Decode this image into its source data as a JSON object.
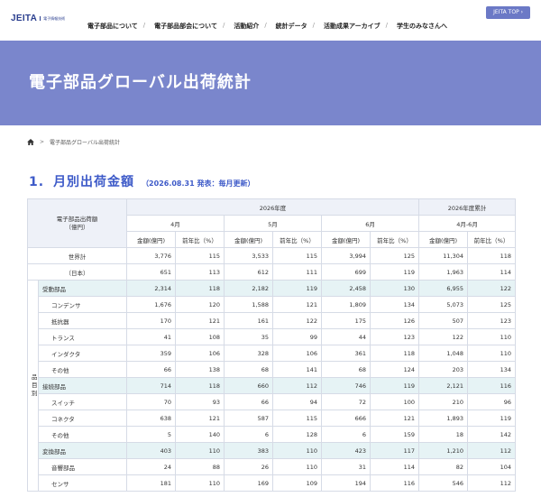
{
  "header": {
    "logo_text": "JEITA",
    "logo_sub": "電子情報技術",
    "top_button": "JEITA TOP ›",
    "nav": [
      "電子部品について",
      "電子部品部会について",
      "活動紹介",
      "統計データ",
      "活動成果アーカイブ",
      "学生のみなさんへ"
    ]
  },
  "banner": {
    "title": "電子部品グローバル出荷統計"
  },
  "breadcrumb": {
    "arrow": ">",
    "current": "電子部品グローバル出荷統計"
  },
  "section": {
    "number": "1.",
    "title": "月別出荷金額",
    "note": "（2026.08.31 発表：毎月更新）"
  },
  "table": {
    "corner": "電子部品出荷額\n（億円）",
    "year_header": "2026年度",
    "cum_header": "2026年度累計",
    "months": [
      "4月",
      "5月",
      "6月",
      "4月-6月"
    ],
    "sub_amount": "金額(億円)",
    "sub_ratio": "前年比（%）",
    "side_label": "品\n目\n別",
    "rows": [
      {
        "name": "世界計",
        "vals": [
          "3,776",
          "115",
          "3,533",
          "115",
          "3,994",
          "125",
          "11,304",
          "118"
        ],
        "group": false,
        "indent": false
      },
      {
        "name": "（日本）",
        "vals": [
          "651",
          "113",
          "612",
          "111",
          "699",
          "119",
          "1,963",
          "114"
        ],
        "group": false,
        "indent": false
      },
      {
        "name": "受動部品",
        "vals": [
          "2,314",
          "118",
          "2,182",
          "119",
          "2,458",
          "130",
          "6,955",
          "122"
        ],
        "group": true,
        "indent": false
      },
      {
        "name": "コンデンサ",
        "vals": [
          "1,676",
          "120",
          "1,588",
          "121",
          "1,809",
          "134",
          "5,073",
          "125"
        ],
        "group": false,
        "indent": true
      },
      {
        "name": "抵抗器",
        "vals": [
          "170",
          "121",
          "161",
          "122",
          "175",
          "126",
          "507",
          "123"
        ],
        "group": false,
        "indent": true
      },
      {
        "name": "トランス",
        "vals": [
          "41",
          "108",
          "35",
          "99",
          "44",
          "123",
          "122",
          "110"
        ],
        "group": false,
        "indent": true
      },
      {
        "name": "インダクタ",
        "vals": [
          "359",
          "106",
          "328",
          "106",
          "361",
          "118",
          "1,048",
          "110"
        ],
        "group": false,
        "indent": true
      },
      {
        "name": "その他",
        "vals": [
          "66",
          "138",
          "68",
          "141",
          "68",
          "124",
          "203",
          "134"
        ],
        "group": false,
        "indent": true
      },
      {
        "name": "接続部品",
        "vals": [
          "714",
          "118",
          "660",
          "112",
          "746",
          "119",
          "2,121",
          "116"
        ],
        "group": true,
        "indent": false
      },
      {
        "name": "スイッチ",
        "vals": [
          "70",
          "93",
          "66",
          "94",
          "72",
          "100",
          "210",
          "96"
        ],
        "group": false,
        "indent": true
      },
      {
        "name": "コネクタ",
        "vals": [
          "638",
          "121",
          "587",
          "115",
          "666",
          "121",
          "1,893",
          "119"
        ],
        "group": false,
        "indent": true
      },
      {
        "name": "その他",
        "vals": [
          "5",
          "140",
          "6",
          "128",
          "6",
          "159",
          "18",
          "142"
        ],
        "group": false,
        "indent": true
      },
      {
        "name": "変換部品",
        "vals": [
          "403",
          "110",
          "383",
          "110",
          "423",
          "117",
          "1,210",
          "112"
        ],
        "group": true,
        "indent": false
      },
      {
        "name": "音響部品",
        "vals": [
          "24",
          "88",
          "26",
          "110",
          "31",
          "114",
          "82",
          "104"
        ],
        "group": false,
        "indent": true
      },
      {
        "name": "センサ",
        "vals": [
          "181",
          "110",
          "169",
          "109",
          "194",
          "116",
          "546",
          "112"
        ],
        "group": false,
        "indent": true
      }
    ]
  }
}
